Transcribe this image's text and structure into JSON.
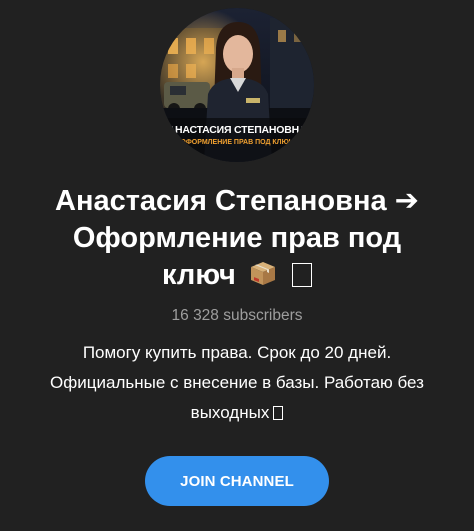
{
  "channel": {
    "avatar": {
      "name_overlay": "АНАСТАСИЯ СТЕПАНОВНА",
      "subtitle_overlay": "ОФОРМЛЕНИЕ ПРАВ ПОД КЛЮЧ"
    },
    "title_line1": "Анастасия Степановна",
    "title_arrow": "➔",
    "title_line2": "Оформление прав под",
    "title_line3": "ключ",
    "title_emoji": "package-icon",
    "subscribers": "16 328 subscribers",
    "description_line1": "Помогу купить права. Срок до 20 дней.",
    "description_line2": "Официальные с внесение в базы. Работаю без",
    "description_line3": "выходных"
  },
  "actions": {
    "join_label": "JOIN CHANNEL"
  },
  "colors": {
    "background": "#212121",
    "accent": "#3390ec",
    "muted_text": "#9e9e9e"
  }
}
